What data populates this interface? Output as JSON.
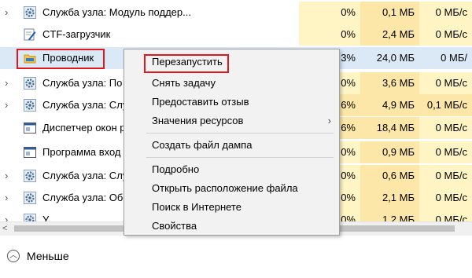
{
  "colors": {
    "cpu_cell": "#fff4c4",
    "mem_cell": "#fde7a8",
    "disk_cell": "#fff4c4",
    "selected_row": "#dbe9f7",
    "highlight_box": "#e0181e",
    "menu_bg": "#f2f2f2"
  },
  "rows": [
    {
      "name": "Служба узла: Модуль поддер...",
      "cpu": "0%",
      "mem": "0,1 МБ",
      "disk": "0 МБ/с",
      "icon": "gear-icon"
    },
    {
      "name": "CTF-загрузчик",
      "cpu": "0%",
      "mem": "2,4 МБ",
      "disk": "0 МБ/с",
      "icon": "pen-icon"
    },
    {
      "name": "Проводник",
      "cpu": "3%",
      "mem": "24,0 МБ",
      "disk": "0 МБ/",
      "icon": "folder-icon"
    },
    {
      "name": "Служба узла: По",
      "cpu": "0%",
      "mem": "3,6 МБ",
      "disk": "0 МБ/с",
      "icon": "gear-icon"
    },
    {
      "name": "Служба узла: Слу",
      "cpu": "6%",
      "mem": "4,9 МБ",
      "disk": "0,1 МБ/с",
      "icon": "gear-icon"
    },
    {
      "name": "Диспетчер окон р",
      "cpu": "6%",
      "mem": "18,4 МБ",
      "disk": "0 МБ/с",
      "icon": "window-icon"
    },
    {
      "name": "Программа вход",
      "cpu": "0%",
      "mem": "0,9 МБ",
      "disk": "0 МБ/с",
      "icon": "window-icon"
    },
    {
      "name": "Служба узла: Слу",
      "cpu": "0%",
      "mem": "0,6 МБ",
      "disk": "0 МБ/с",
      "icon": "gear-icon"
    },
    {
      "name": "Служба узла: Об",
      "cpu": "0%",
      "mem": "2,1 МБ",
      "disk": "0 МБ/с",
      "icon": "gear-icon"
    },
    {
      "name": "У",
      "cpu": "0%",
      "mem": "1,2 МБ",
      "disk": "0 МБ/с",
      "icon": "gear-icon"
    }
  ],
  "menu": {
    "items": [
      {
        "label": "Перезапустить"
      },
      {
        "label": "Снять задачу"
      },
      {
        "label": "Предоставить отзыв"
      },
      {
        "label": "Значения ресурсов",
        "submenu": "›"
      },
      {
        "label": "Создать файл дампа"
      },
      {
        "label": "Подробно"
      },
      {
        "label": "Открыть расположение файла"
      },
      {
        "label": "Поиск в Интернете"
      },
      {
        "label": "Свойства"
      }
    ]
  },
  "footer": {
    "label": "Меньше",
    "toggle_glyph": "︿"
  },
  "scrollbar": {
    "left_arrow": "<"
  }
}
